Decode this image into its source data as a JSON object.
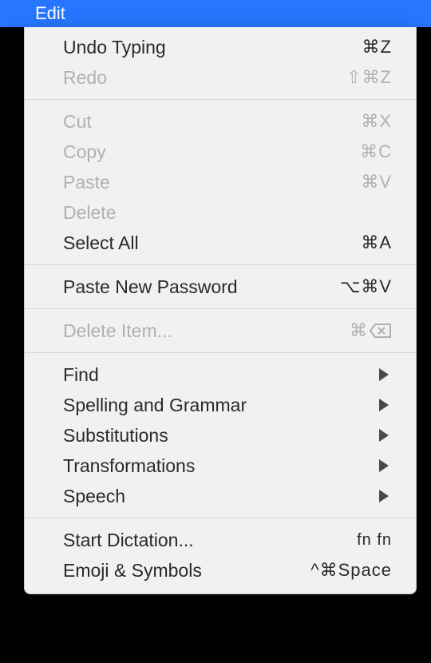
{
  "menubar": {
    "title": "Edit"
  },
  "menu": {
    "undo": {
      "label": "Undo Typing",
      "shortcut": "⌘Z"
    },
    "redo": {
      "label": "Redo",
      "shortcut": "⇧⌘Z"
    },
    "cut": {
      "label": "Cut",
      "shortcut": "⌘X"
    },
    "copy": {
      "label": "Copy",
      "shortcut": "⌘C"
    },
    "paste": {
      "label": "Paste",
      "shortcut": "⌘V"
    },
    "delete": {
      "label": "Delete",
      "shortcut": ""
    },
    "selectAll": {
      "label": "Select All",
      "shortcut": "⌘A"
    },
    "pasteNewPw": {
      "label": "Paste New Password",
      "shortcut": "⌥⌘V"
    },
    "deleteItem": {
      "label": "Delete Item...",
      "shortcut_prefix": "⌘"
    },
    "find": {
      "label": "Find"
    },
    "spelling": {
      "label": "Spelling and Grammar"
    },
    "subst": {
      "label": "Substitutions"
    },
    "transform": {
      "label": "Transformations"
    },
    "speech": {
      "label": "Speech"
    },
    "dictation": {
      "label": "Start Dictation...",
      "shortcut": "fn fn"
    },
    "emoji": {
      "label": "Emoji & Symbols",
      "shortcut": "^⌘Space"
    }
  }
}
